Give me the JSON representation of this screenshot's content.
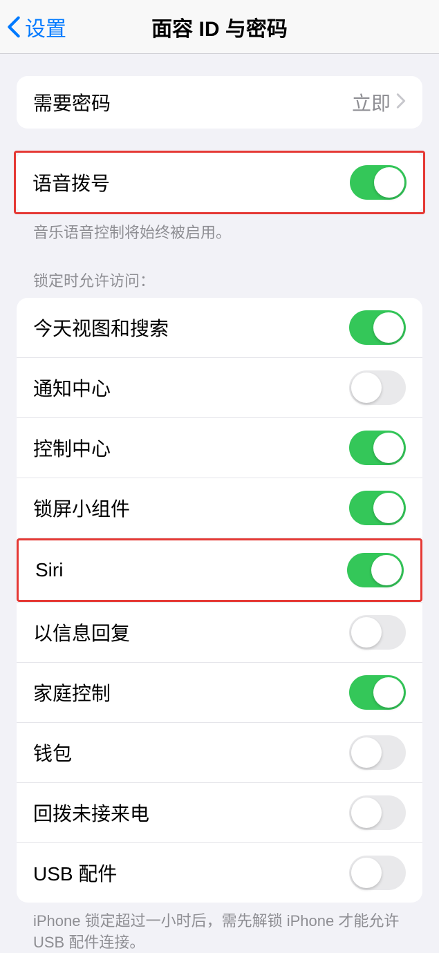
{
  "header": {
    "back_label": "设置",
    "title": "面容 ID 与密码"
  },
  "require_passcode": {
    "label": "需要密码",
    "value": "立即"
  },
  "voice_dial": {
    "label": "语音拨号",
    "enabled": true,
    "footer": "音乐语音控制将始终被启用。"
  },
  "lock_section": {
    "header": "锁定时允许访问：",
    "items": [
      {
        "label": "今天视图和搜索",
        "enabled": true
      },
      {
        "label": "通知中心",
        "enabled": false
      },
      {
        "label": "控制中心",
        "enabled": true
      },
      {
        "label": "锁屏小组件",
        "enabled": true
      },
      {
        "label": "Siri",
        "enabled": true
      },
      {
        "label": "以信息回复",
        "enabled": false
      },
      {
        "label": "家庭控制",
        "enabled": true
      },
      {
        "label": "钱包",
        "enabled": false
      },
      {
        "label": "回拨未接来电",
        "enabled": false
      },
      {
        "label": "USB 配件",
        "enabled": false
      }
    ],
    "footer": "iPhone 锁定超过一小时后，需先解锁 iPhone 才能允许USB 配件连接。"
  }
}
